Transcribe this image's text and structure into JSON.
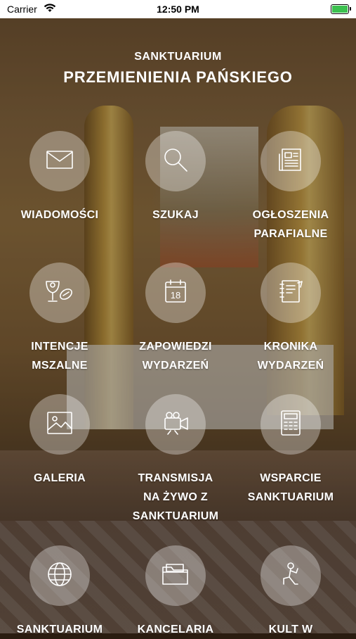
{
  "status_bar": {
    "carrier": "Carrier",
    "time": "12:50 PM",
    "battery_color": "#3cc14f"
  },
  "header": {
    "subtitle": "SANKTUARIUM",
    "title": "PRZEMIENIENIA PAŃSKIEGO"
  },
  "menu": {
    "items": [
      {
        "icon": "envelope-icon",
        "lines": [
          "WIADOMOŚCI"
        ]
      },
      {
        "icon": "magnifier-icon",
        "lines": [
          "SZUKAJ"
        ]
      },
      {
        "icon": "newspaper-icon",
        "lines": [
          "OGŁOSZENIA",
          "PARAFIALNE"
        ]
      },
      {
        "icon": "chalice-host-icon",
        "lines": [
          "INTENCJE",
          "MSZALNE"
        ]
      },
      {
        "icon": "calendar-icon",
        "lines": [
          "ZAPOWIEDZI",
          "WYDARZEŃ"
        ]
      },
      {
        "icon": "notebook-icon",
        "lines": [
          "KRONIKA",
          "WYDARZEŃ"
        ]
      },
      {
        "icon": "picture-icon",
        "lines": [
          "GALERIA"
        ]
      },
      {
        "icon": "video-camera-icon",
        "lines": [
          "TRANSMISJA",
          "NA ŻYWO Z",
          "SANKTUARIUM"
        ]
      },
      {
        "icon": "calculator-icon",
        "lines": [
          "WSPARCIE",
          "SANKTUARIUM"
        ]
      },
      {
        "icon": "globe-icon",
        "lines": [
          "SANKTUARIUM"
        ]
      },
      {
        "icon": "folder-icon",
        "lines": [
          "KANCELARIA"
        ]
      },
      {
        "icon": "kneeling-person-icon",
        "lines": [
          "KULT W"
        ]
      }
    ]
  }
}
